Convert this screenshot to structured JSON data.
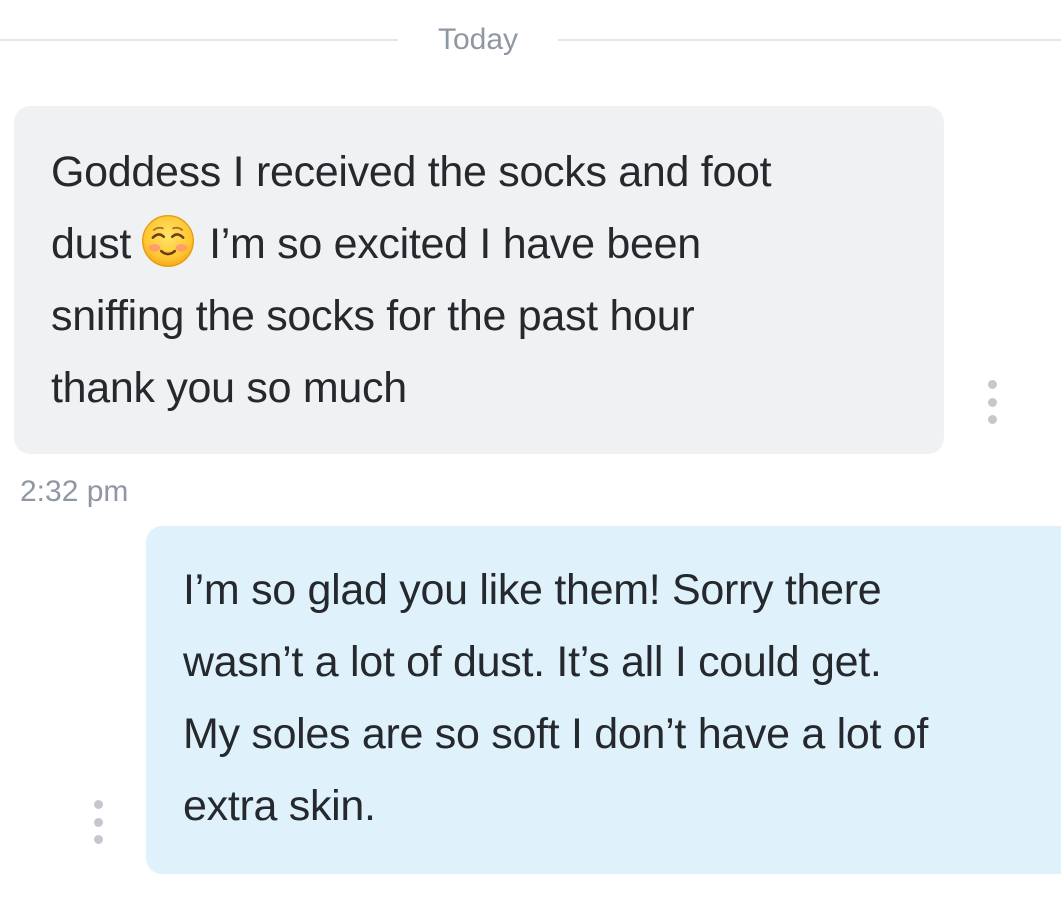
{
  "date_divider": {
    "label": "Today"
  },
  "messages": [
    {
      "direction": "incoming",
      "lines": [
        {
          "text": "Goddess I received the socks and foot"
        },
        {
          "before": "dust",
          "emoji": "smiling-face-with-smiling-eyes",
          "after": "I’m so excited I have been"
        },
        {
          "text": "sniffing the socks for the past hour"
        },
        {
          "text": "thank you so much"
        }
      ],
      "timestamp": "2:32 pm",
      "options_icon": "vertical-ellipsis-icon"
    },
    {
      "direction": "outgoing",
      "lines": [
        {
          "text": "I’m so glad you like them! Sorry there"
        },
        {
          "text": "wasn’t a lot of dust. It’s all I could get."
        },
        {
          "text": "My soles are so soft I don’t have a lot of"
        },
        {
          "text": "extra skin."
        }
      ],
      "options_icon": "vertical-ellipsis-icon"
    }
  ],
  "colors": {
    "incoming_bubble": "#f0f1f3",
    "outgoing_bubble": "#dff2fb",
    "message_text": "#25282d",
    "meta_text": "#8f97a3",
    "divider_line": "#e4e6ea",
    "options_dots": "#c4c8ce"
  }
}
